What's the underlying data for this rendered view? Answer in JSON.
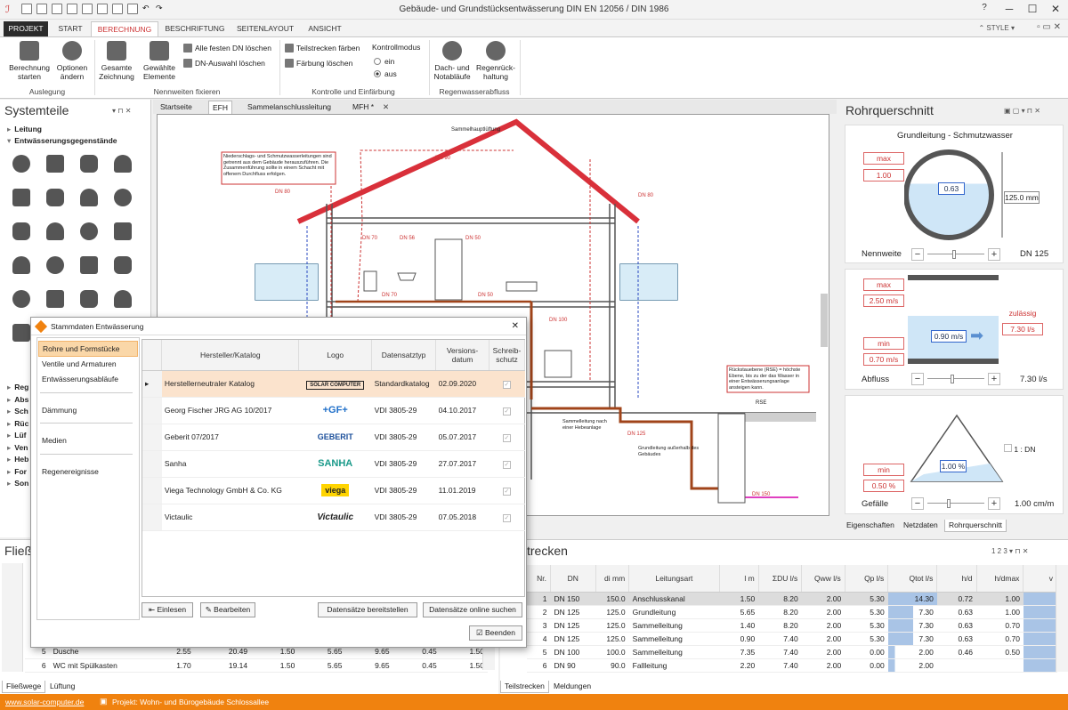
{
  "window": {
    "title": "Gebäude- und Grundstücksentwässerung DIN EN 12056 / DIN 1986",
    "help": "?"
  },
  "ribbon_tabs": [
    "PROJEKT",
    "START",
    "BERECHNUNG",
    "BESCHRIFTUNG",
    "SEITENLAYOUT",
    "ANSICHT"
  ],
  "style_label": "STYLE",
  "ribbon": {
    "berechnung_starten": "Berechnung starten",
    "optionen_aendern": "Optionen ändern",
    "group_ausleg": "Auslegung",
    "gesamte_zeichnung": "Gesamte Zeichnung",
    "gewaehlte_elemente": "Gewählte Elemente",
    "alle_festen_dn_loeschen": "Alle festen DN löschen",
    "dn_auswahl_loeschen": "DN-Auswahl löschen",
    "group_nennweiten": "Nennweiten fixieren",
    "teilstrecken_faerben": "Teilstrecken färben",
    "faerbung_loeschen": "Färbung löschen",
    "kontrollmodus": "Kontrollmodus",
    "ein": "ein",
    "aus": "aus",
    "group_kontrolle": "Kontrolle und Einfärbung",
    "dach_notablaeufe": "Dach- und Notabläufe",
    "regenrueckhaltung": "Regenrück- haltung",
    "group_regen": "Regenwasserabfluss"
  },
  "left_panel": {
    "title": "Systemteile",
    "tree_leitung": "Leitung",
    "tree_entw": "Entwässerungsgegenstände",
    "tree_more": [
      "Reg",
      "Abs",
      "Sch",
      "Rüc",
      "Lüf",
      "Ven",
      "Heb",
      "For",
      "Son"
    ]
  },
  "doc_tabs": [
    "Startseite",
    "EFH",
    "Sammelanschlussleitung",
    "MFH *"
  ],
  "drawing": {
    "labels": [
      "Sammelhauptlüftung",
      "DN 90",
      "DN 80",
      "DN 80",
      "DN 70",
      "DN 56",
      "DN 50",
      "DN 100",
      "DN 125",
      "DN 150",
      "RSE",
      "DN 70",
      "DN 50"
    ],
    "note1": "Niederschlags- und Schmutzwasserleitungen sind getrennt aus dem Gebäude herauszuführen. Die Zusammenführung sollte in einem Schacht mit offenem Durchfluss erfolgen.",
    "note2": "Rückstauebene (RSE) = höchste Ebene, bis zu der das Wasser in einer Entwässerungsanlage ansteigen kann.",
    "note3": "Sammelleitung nach einer Hebeanlage",
    "note4": "Grundleitung außerhalb des Gebäudes"
  },
  "right_panel": {
    "title": "Rohrquerschnitt",
    "subtitle": "Grundleitung - Schmutzwasser",
    "max": "max",
    "max_val": "1.00",
    "fill": "0.63",
    "diam": "125.0 mm",
    "nennweite_label": "Nennweite",
    "nennweite_val": "DN 125",
    "v_max": "max",
    "v_max_val": "2.50 m/s",
    "v_min": "min",
    "v_min_val": "0.70 m/s",
    "v": "0.90 m/s",
    "zulaessig": "zulässig",
    "zul_val": "7.30 l/s",
    "abfluss_label": "Abfluss",
    "abfluss_val": "7.30 l/s",
    "g_min": "min",
    "g_min_val": "0.50 %",
    "g_val": "1.00 %",
    "dn_check": "1 : DN",
    "gefaelle_label": "Gefälle",
    "gefaelle_val": "1.00 cm/m",
    "fill_fraction": 0.63,
    "abfluss_fraction": 0.4,
    "gefaelle_fraction": 0.35,
    "tabs": [
      "Eigenschaften",
      "Netzdaten",
      "Rohrquerschnitt"
    ]
  },
  "bottom_left": {
    "title": "Fließ",
    "tabs": [
      "Fließwege",
      "Lüftung"
    ],
    "rows": [
      {
        "nr": "5",
        "name": "Dusche",
        "c1": "2.55",
        "c2": "20.49",
        "c3": "1.50",
        "c4": "5.65",
        "c5": "9.65",
        "c6": "0.45",
        "c7": "1.50"
      },
      {
        "nr": "6",
        "name": "WC mit Spülkasten",
        "c1": "1.70",
        "c2": "19.14",
        "c3": "1.50",
        "c4": "5.65",
        "c5": "9.65",
        "c6": "0.45",
        "c7": "1.50"
      }
    ]
  },
  "bottom_right": {
    "title": "trecken",
    "tabs": [
      "Teilstrecken",
      "Meldungen"
    ],
    "headers": [
      "Nr.",
      "DN",
      "di mm",
      "Leitungsart",
      "l m",
      "ΣDU l/s",
      "Qww l/s",
      "Qp l/s",
      "Qtot l/s",
      "h/d",
      "h/dmax",
      "v"
    ],
    "rows": [
      {
        "nr": "1",
        "dn": "DN 150",
        "di": "150.0",
        "art": "Anschlusskanal",
        "l": "1.50",
        "du": "8.20",
        "qww": "2.00",
        "qp": "5.30",
        "qtot": "14.30",
        "hd": "0.72",
        "hdmax": "1.00"
      },
      {
        "nr": "2",
        "dn": "DN 125",
        "di": "125.0",
        "art": "Grundleitung",
        "l": "5.65",
        "du": "8.20",
        "qww": "2.00",
        "qp": "5.30",
        "qtot": "7.30",
        "hd": "0.63",
        "hdmax": "1.00"
      },
      {
        "nr": "3",
        "dn": "DN 125",
        "di": "125.0",
        "art": "Sammelleitung",
        "l": "1.40",
        "du": "8.20",
        "qww": "2.00",
        "qp": "5.30",
        "qtot": "7.30",
        "hd": "0.63",
        "hdmax": "0.70"
      },
      {
        "nr": "4",
        "dn": "DN 125",
        "di": "125.0",
        "art": "Sammelleitung",
        "l": "0.90",
        "du": "7.40",
        "qww": "2.00",
        "qp": "5.30",
        "qtot": "7.30",
        "hd": "0.63",
        "hdmax": "0.70"
      },
      {
        "nr": "5",
        "dn": "DN 100",
        "di": "100.0",
        "art": "Sammelleitung",
        "l": "7.35",
        "du": "7.40",
        "qww": "2.00",
        "qp": "0.00",
        "qtot": "2.00",
        "hd": "0.46",
        "hdmax": "0.50"
      },
      {
        "nr": "6",
        "dn": "DN 90",
        "di": "90.0",
        "art": "Fallleitung",
        "l": "2.20",
        "du": "7.40",
        "qww": "2.00",
        "qp": "0.00",
        "qtot": "2.00",
        "hd": "",
        "hdmax": ""
      }
    ]
  },
  "dialog": {
    "title": "Stammdaten Entwässerung",
    "nav": [
      "Rohre und Formstücke",
      "Ventile und Armaturen",
      "Entwässerungsabläufe",
      "Dämmung",
      "Medien",
      "Regenereignisse"
    ],
    "headers": [
      "Hersteller/Katalog",
      "Logo",
      "Datensatztyp",
      "Versions-datum",
      "Schreib-schutz"
    ],
    "rows": [
      {
        "name": "Herstellerneutraler Katalog",
        "logo": "SOLAR COMPUTER",
        "type": "Standardkatalog",
        "date": "02.09.2020"
      },
      {
        "name": "Georg Fischer JRG AG 10/2017",
        "logo": "+GF+",
        "type": "VDI 3805-29",
        "date": "04.10.2017"
      },
      {
        "name": "Geberit 07/2017",
        "logo": "GEBERIT",
        "type": "VDI 3805-29",
        "date": "05.07.2017"
      },
      {
        "name": "Sanha",
        "logo": "SANHA",
        "type": "VDI 3805-29",
        "date": "27.07.2017"
      },
      {
        "name": "Viega Technology GmbH & Co. KG",
        "logo": "viega",
        "type": "VDI 3805-29",
        "date": "11.01.2019"
      },
      {
        "name": "Victaulic",
        "logo": "Victaulic",
        "type": "VDI 3805-29",
        "date": "07.05.2018"
      }
    ],
    "btn_einlesen": "Einlesen",
    "btn_bearbeiten": "Bearbeiten",
    "btn_bereitstellen": "Datensätze bereitstellen",
    "btn_online": "Datensätze online suchen",
    "btn_beenden": "Beenden"
  },
  "status": {
    "url": "www.solar-computer.de",
    "project": "Projekt: Wohn- und Bürogebäude Schlossallee"
  },
  "colors": {
    "accent": "#f0820f",
    "ribbon_active": "#cc3333",
    "roof": "#d9303a"
  }
}
